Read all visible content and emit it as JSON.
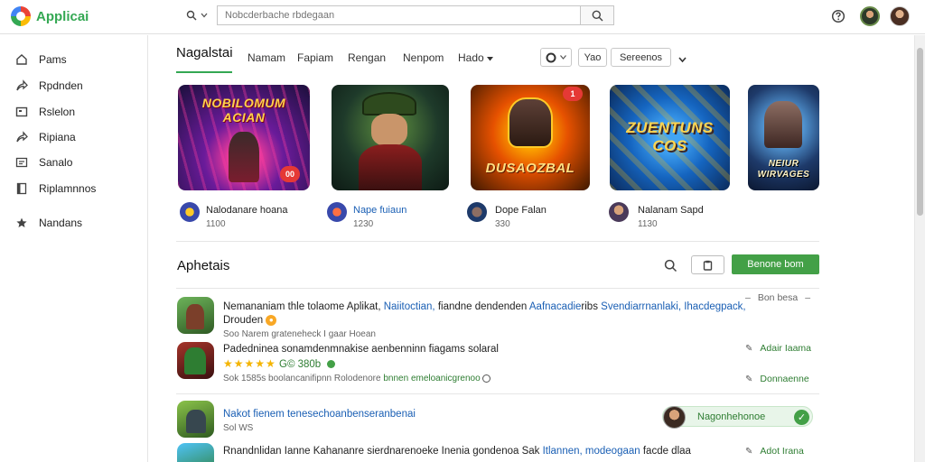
{
  "header": {
    "logo_text": "Applicai",
    "search_placeholder": "Nobcderbache rbdegaan",
    "search_icon": "search-icon",
    "dropdown_icon": "chevron-down-icon",
    "help_icon": "help-icon"
  },
  "sidebar": {
    "items": [
      {
        "label": "Pams",
        "icon": "home-icon"
      },
      {
        "label": "Rpdnden",
        "icon": "share-icon"
      },
      {
        "label": "Rslelon",
        "icon": "window-icon"
      },
      {
        "label": "Ripiana",
        "icon": "share-icon"
      },
      {
        "label": "Sanalo",
        "icon": "list-icon"
      },
      {
        "label": "Riplamnnos",
        "icon": "bookmark-icon"
      },
      {
        "label": "Nandans",
        "icon": "star-icon"
      }
    ]
  },
  "tabs": {
    "active": "Nagalstai",
    "items": [
      "Namam",
      "Fapiam",
      "Rengan",
      "Nenpom",
      "Hado"
    ],
    "filter_icon": "C",
    "filter_two": "Yao",
    "filter_three": "Sereenos"
  },
  "featured": [
    {
      "art_title": "NOBILOMUM ACIAN",
      "badge_text": "00",
      "name": "Nalodanare hoana",
      "sub": "1100"
    },
    {
      "art_title": "",
      "name": "Nape fuiaun",
      "sub": "1230"
    },
    {
      "art_title": "DUSAOZBAL",
      "badge_text": "1",
      "name": "Dope Falan",
      "sub": "330"
    },
    {
      "art_title": "ZUENTUNS COS",
      "name": "Nalanam Sapd",
      "sub": "1130"
    },
    {
      "art_title": "NEIUR WIRVAGES",
      "name": "",
      "sub": ""
    }
  ],
  "section": {
    "title": "Aphetais",
    "search_icon": "search-icon",
    "box_icon": "clipboard-icon",
    "primary_label": "Benone bom"
  },
  "rows": [
    {
      "line1_a": "Nemananiam thle tolaome Aplikat,",
      "line1_link1": "Naiitoctian,",
      "line1_b": "fiandne dendenden",
      "line1_link2": "Aafnacadie",
      "line1_c": "ribs",
      "line1_link3": "Svendiarrnanlaki,",
      "line1_link4": "Ihacdegpack,",
      "line2": "Drouden",
      "line3": "Soo Narem grateneheck I gaar  Hoean",
      "side": "Bon besa"
    },
    {
      "line1": "Padedninea sonamdenmnakise aenbenninn fiagams solaral",
      "rating_text": "G© 380b",
      "line3_a": "Sok  1585s boolancanifipnn  Rolodenore",
      "line3_link": "bnnen emeloanicgrenoo",
      "action1": "Adair Iaama",
      "action2": "Donnaenne"
    },
    {
      "line1": "Nakot fienem",
      "line1_link": "tenesechoanbenseranbenai",
      "line2": "Sol WS",
      "pill_label": "Nagonhehonoe"
    },
    {
      "line1_a": "Rnandnlidan Ianne Kahananre sierdnarenoeke Inenia gondenoa Sak",
      "line1_link": "Itlannen, modeogaan",
      "line1_b": "facde dlaa",
      "action1": "Adot Irana"
    }
  ],
  "colors": {
    "accent_green": "#43a047",
    "link_blue": "#1a5fb4",
    "star_gold": "#f4b400"
  }
}
